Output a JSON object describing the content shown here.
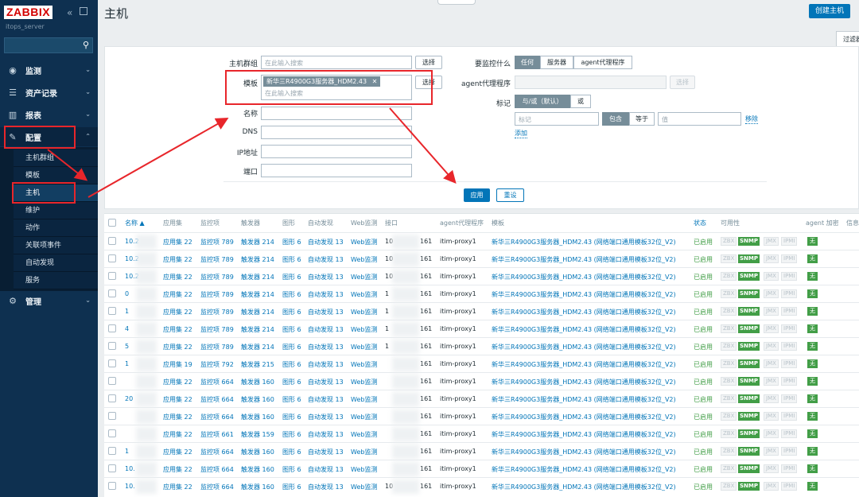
{
  "brand": {
    "logo": "ZABBIX",
    "server": "itops_server"
  },
  "nav": {
    "monitoring": "监测",
    "inventory": "资产记录",
    "reports": "报表",
    "configuration": "配置",
    "administration": "管理",
    "sub_items": [
      "主机群组",
      "模板",
      "主机",
      "维护",
      "动作",
      "关联项事件",
      "自动发现",
      "服务"
    ]
  },
  "header": {
    "title": "主机",
    "create_button": "创建主机",
    "filter_tab": "过滤器"
  },
  "filter": {
    "host_groups_label": "主机群组",
    "templates_label": "模板",
    "name_label": "名称",
    "dns_label": "DNS",
    "ip_label": "IP地址",
    "port_label": "端口",
    "search_placeholder": "在此输入搜索",
    "select_button": "选择",
    "template_chip": "新华三R4900G3服务器_HDM2.43",
    "monitored_by_label": "要监控什么",
    "monitored_by_options": [
      "任何",
      "服务器",
      "agent代理程序"
    ],
    "proxy_label": "agent代理程序",
    "tags_label": "标记",
    "tag_op_options": [
      "与/或（默认）",
      "或"
    ],
    "tag_placeholder": "标记",
    "tag_match_options": [
      "包含",
      "等于"
    ],
    "value_placeholder": "值",
    "remove_link": "移除",
    "add_link": "添加",
    "apply_button": "应用",
    "reset_button": "重设"
  },
  "table": {
    "headers": [
      "名称 ▲",
      "应用集",
      "监控项",
      "触发器",
      "图形",
      "自动发现",
      "Web监测",
      "接口",
      "agent代理程序",
      "模板",
      "状态",
      "可用性",
      "agent 加密",
      "信息"
    ],
    "availability_tags": [
      "ZBX",
      "SNMP",
      "JMX",
      "IPMI"
    ],
    "encryption": "无",
    "rows": [
      {
        "name": "10.2",
        "apps": "应用集 22",
        "items": "监控项 789",
        "triggers": "触发器 214",
        "graphs": "图形 6",
        "discovery": "自动发现 13",
        "web": "Web监测",
        "iface": "10",
        "port": "161",
        "proxy": "itim-proxy1",
        "template": "新华三R4900G3服务器_HDM2.43 (网络端口通用模板32位_V2)",
        "status": "已启用"
      },
      {
        "name": "10.2",
        "apps": "应用集 22",
        "items": "监控项 789",
        "triggers": "触发器 214",
        "graphs": "图形 6",
        "discovery": "自动发现 13",
        "web": "Web监测",
        "iface": "10",
        "port": "161",
        "proxy": "itim-proxy1",
        "template": "新华三R4900G3服务器_HDM2.43 (网络端口通用模板32位_V2)",
        "status": "已启用"
      },
      {
        "name": "10.2",
        "apps": "应用集 22",
        "items": "监控项 789",
        "triggers": "触发器 214",
        "graphs": "图形 6",
        "discovery": "自动发现 13",
        "web": "Web监测",
        "iface": "10",
        "port": "161",
        "proxy": "itim-proxy1",
        "template": "新华三R4900G3服务器_HDM2.43 (网络端口通用模板32位_V2)",
        "status": "已启用"
      },
      {
        "name": "0",
        "apps": "应用集 22",
        "items": "监控项 789",
        "triggers": "触发器 214",
        "graphs": "图形 6",
        "discovery": "自动发现 13",
        "web": "Web监测",
        "iface": "1",
        "port": "161",
        "proxy": "itim-proxy1",
        "template": "新华三R4900G3服务器_HDM2.43 (网络端口通用模板32位_V2)",
        "status": "已启用"
      },
      {
        "name": "1",
        "apps": "应用集 22",
        "items": "监控项 789",
        "triggers": "触发器 214",
        "graphs": "图形 6",
        "discovery": "自动发现 13",
        "web": "Web监测",
        "iface": "1",
        "port": "161",
        "proxy": "itim-proxy1",
        "template": "新华三R4900G3服务器_HDM2.43 (网络端口通用模板32位_V2)",
        "status": "已启用"
      },
      {
        "name": "4",
        "apps": "应用集 22",
        "items": "监控项 789",
        "triggers": "触发器 214",
        "graphs": "图形 6",
        "discovery": "自动发现 13",
        "web": "Web监测",
        "iface": "1",
        "port": "161",
        "proxy": "itim-proxy1",
        "template": "新华三R4900G3服务器_HDM2.43 (网络端口通用模板32位_V2)",
        "status": "已启用"
      },
      {
        "name": "5",
        "apps": "应用集 22",
        "items": "监控项 789",
        "triggers": "触发器 214",
        "graphs": "图形 6",
        "discovery": "自动发现 13",
        "web": "Web监测",
        "iface": "1",
        "port": "161",
        "proxy": "itim-proxy1",
        "template": "新华三R4900G3服务器_HDM2.43 (网络端口通用模板32位_V2)",
        "status": "已启用"
      },
      {
        "name": "1",
        "apps": "应用集 19",
        "items": "监控项 792",
        "triggers": "触发器 215",
        "graphs": "图形 6",
        "discovery": "自动发现 13",
        "web": "Web监测",
        "iface": "",
        "port": "161",
        "proxy": "itim-proxy1",
        "template": "新华三R4900G3服务器_HDM2.43 (网络端口通用模板32位_V2)",
        "status": "已启用"
      },
      {
        "name": "",
        "apps": "应用集 22",
        "items": "监控项 664",
        "triggers": "触发器 160",
        "graphs": "图形 6",
        "discovery": "自动发现 13",
        "web": "Web监测",
        "iface": "",
        "port": "161",
        "proxy": "itim-proxy1",
        "template": "新华三R4900G3服务器_HDM2.43 (网络端口通用模板32位_V2)",
        "status": "已启用"
      },
      {
        "name": "20",
        "apps": "应用集 22",
        "items": "监控项 664",
        "triggers": "触发器 160",
        "graphs": "图形 6",
        "discovery": "自动发现 13",
        "web": "Web监测",
        "iface": "",
        "port": "161",
        "proxy": "itim-proxy1",
        "template": "新华三R4900G3服务器_HDM2.43 (网络端口通用模板32位_V2)",
        "status": "已启用"
      },
      {
        "name": "",
        "apps": "应用集 22",
        "items": "监控项 664",
        "triggers": "触发器 160",
        "graphs": "图形 6",
        "discovery": "自动发现 13",
        "web": "Web监测",
        "iface": "",
        "port": "161",
        "proxy": "itim-proxy1",
        "template": "新华三R4900G3服务器_HDM2.43 (网络端口通用模板32位_V2)",
        "status": "已启用"
      },
      {
        "name": "",
        "apps": "应用集 22",
        "items": "监控项 661",
        "triggers": "触发器 159",
        "graphs": "图形 6",
        "discovery": "自动发现 13",
        "web": "Web监测",
        "iface": "",
        "port": "161",
        "proxy": "itim-proxy1",
        "template": "新华三R4900G3服务器_HDM2.43 (网络端口通用模板32位_V2)",
        "status": "已启用"
      },
      {
        "name": "1",
        "apps": "应用集 22",
        "items": "监控项 664",
        "triggers": "触发器 160",
        "graphs": "图形 6",
        "discovery": "自动发现 13",
        "web": "Web监测",
        "iface": "",
        "port": "161",
        "proxy": "itim-proxy1",
        "template": "新华三R4900G3服务器_HDM2.43 (网络端口通用模板32位_V2)",
        "status": "已启用"
      },
      {
        "name": "10.",
        "apps": "应用集 22",
        "items": "监控项 664",
        "triggers": "触发器 160",
        "graphs": "图形 6",
        "discovery": "自动发现 13",
        "web": "Web监测",
        "iface": "",
        "port": "161",
        "proxy": "itim-proxy1",
        "template": "新华三R4900G3服务器_HDM2.43 (网络端口通用模板32位_V2)",
        "status": "已启用"
      },
      {
        "name": "10.",
        "apps": "应用集 22",
        "items": "监控项 664",
        "triggers": "触发器 160",
        "graphs": "图形 6",
        "discovery": "自动发现 13",
        "web": "Web监测",
        "iface": "10",
        "port": "161",
        "proxy": "itim-proxy1",
        "template": "新华三R4900G3服务器_HDM2.43 (网络端口通用模板32位_V2)",
        "status": "已启用"
      }
    ]
  }
}
